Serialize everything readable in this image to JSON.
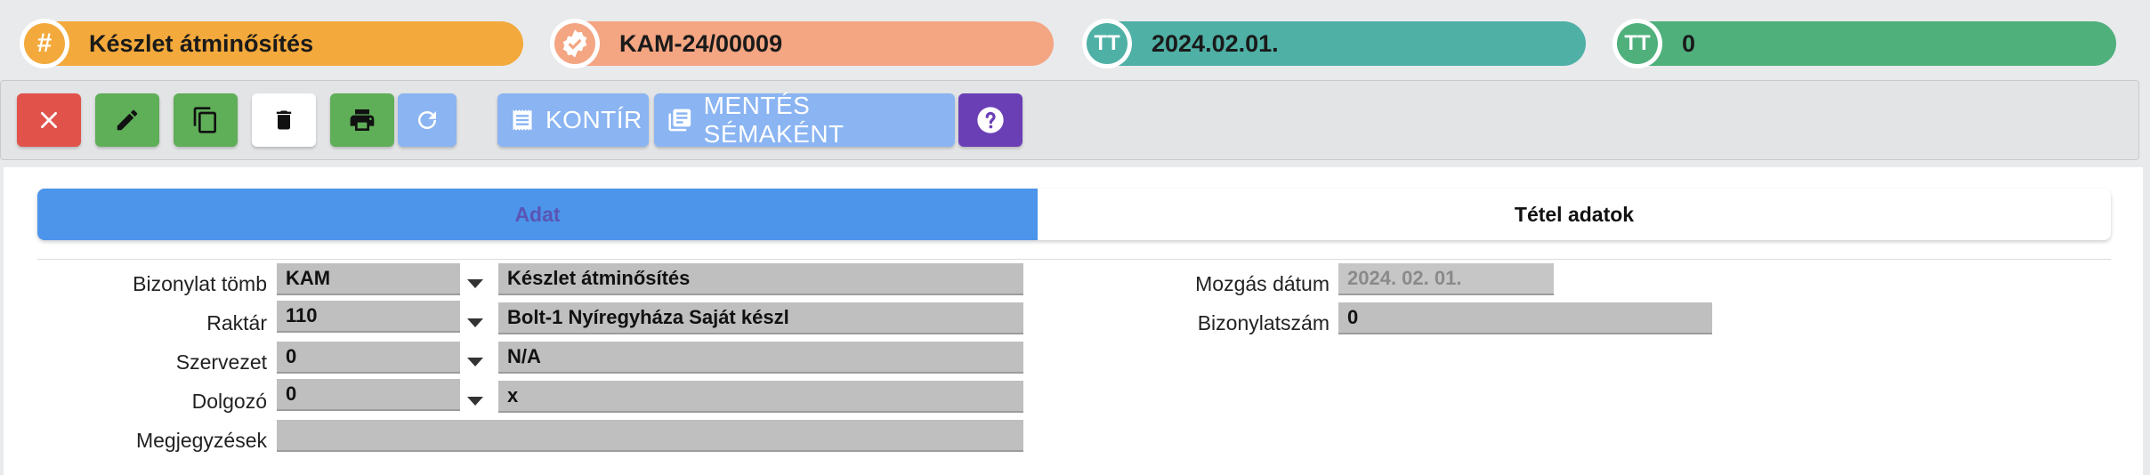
{
  "header": {
    "type_label": "Készlet átminősítés",
    "doc_number": "KAM-24/00009",
    "date": "2024.02.01.",
    "count": "0",
    "icons": [
      "hash-icon",
      "verified-badge-icon",
      "text-type-icon",
      "text-type-icon"
    ],
    "colors": {
      "type": "#f3a93b",
      "number": "#f4a582",
      "date": "#4fb0a6",
      "count": "#4fb07c"
    }
  },
  "toolbar": {
    "close_icon": "close-icon",
    "edit_icon": "pencil-icon",
    "copy_icon": "copy-icon",
    "delete_icon": "trash-icon",
    "print_icon": "printer-icon",
    "refresh_icon": "refresh-icon",
    "kontir_label": "KONTÍR",
    "save_schema_label": "MENTÉS SÉMAKÉNT",
    "help_icon": "help-icon"
  },
  "tabs": [
    {
      "label": "Adat",
      "active": true
    },
    {
      "label": "Tétel adatok",
      "active": false
    }
  ],
  "form": {
    "bizonylat_tomb": {
      "label": "Bizonylat tömb",
      "code": "KAM",
      "name": "Készlet átminősítés"
    },
    "raktar": {
      "label": "Raktár",
      "code": "110",
      "name": "Bolt-1 Nyíregyháza Saját készl"
    },
    "szervezet": {
      "label": "Szervezet",
      "code": "0",
      "name": "N/A"
    },
    "dolgozo": {
      "label": "Dolgozó",
      "code": "0",
      "name": "x"
    },
    "megjegyzesek": {
      "label": "Megjegyzések",
      "value": ""
    },
    "mozgas_datum": {
      "label": "Mozgás dátum",
      "value": "2024. 02. 01."
    },
    "bizonylatszam": {
      "label": "Bizonylatszám",
      "value": "0"
    }
  }
}
